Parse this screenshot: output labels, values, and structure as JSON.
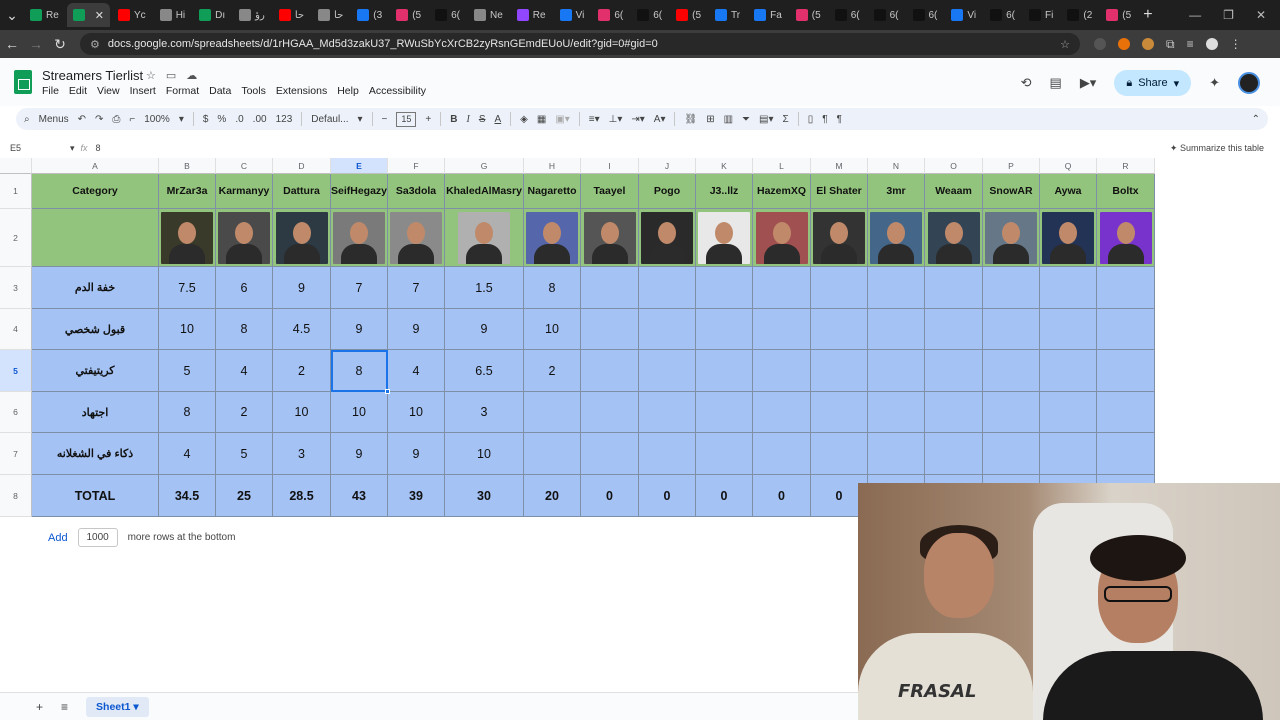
{
  "browser": {
    "tabs": [
      {
        "label": "Re",
        "color": "#0f9d58",
        "active": false
      },
      {
        "label": "",
        "color": "#0f9d58",
        "active": true
      },
      {
        "label": "Yc",
        "color": "#ff0000",
        "active": false
      },
      {
        "label": "Hi",
        "color": "#888888",
        "active": false
      },
      {
        "label": "Dı",
        "color": "#0f9d58",
        "active": false
      },
      {
        "label": "رؤ",
        "color": "#888888",
        "active": false
      },
      {
        "label": "حا",
        "color": "#ff0000",
        "active": false
      },
      {
        "label": "حا",
        "color": "#888888",
        "active": false
      },
      {
        "label": "(3",
        "color": "#1877f2",
        "active": false
      },
      {
        "label": "(5",
        "color": "#e1306c",
        "active": false
      },
      {
        "label": "6(",
        "color": "#111111",
        "active": false
      },
      {
        "label": "Ne",
        "color": "#888888",
        "active": false
      },
      {
        "label": "Re",
        "color": "#9146ff",
        "active": false
      },
      {
        "label": "Vi",
        "color": "#1877f2",
        "active": false
      },
      {
        "label": "6(",
        "color": "#e1306c",
        "active": false
      },
      {
        "label": "6(",
        "color": "#111111",
        "active": false
      },
      {
        "label": "(5",
        "color": "#ff0000",
        "active": false
      },
      {
        "label": "Tr",
        "color": "#1877f2",
        "active": false
      },
      {
        "label": "Fa",
        "color": "#1877f2",
        "active": false
      },
      {
        "label": "(5",
        "color": "#e1306c",
        "active": false
      },
      {
        "label": "6(",
        "color": "#111111",
        "active": false
      },
      {
        "label": "6(",
        "color": "#111111",
        "active": false
      },
      {
        "label": "6(",
        "color": "#111111",
        "active": false
      },
      {
        "label": "Vi",
        "color": "#1877f2",
        "active": false
      },
      {
        "label": "6(",
        "color": "#111111",
        "active": false
      },
      {
        "label": "Fi",
        "color": "#111111",
        "active": false
      },
      {
        "label": "(2",
        "color": "#111111",
        "active": false
      },
      {
        "label": "(5",
        "color": "#e1306c",
        "active": false
      }
    ],
    "new_tab": "+",
    "url": "docs.google.com/spreadsheets/d/1rHGAA_Md5d3zakU37_RWuSbYcXrCB2zyRsnGEmdEUoU/edit?gid=0#gid=0"
  },
  "sheets": {
    "title": "Streamers Tierlist",
    "menu": [
      "File",
      "Edit",
      "View",
      "Insert",
      "Format",
      "Data",
      "Tools",
      "Extensions",
      "Help",
      "Accessibility"
    ],
    "share_label": "Share",
    "toolbar": {
      "menus_label": "Menus",
      "zoom": "100%",
      "currency": "$",
      "percent": "%",
      "dec_decrease": ".0",
      "dec_increase": ".00",
      "number_format": "123",
      "font": "Defaul...",
      "font_size": "15",
      "bold": "B",
      "italic": "I"
    },
    "formula_bar": {
      "cell_ref": "E5",
      "fx": "fx",
      "value": "8",
      "summarize": "Summarize this table"
    },
    "columns": [
      "A",
      "B",
      "C",
      "D",
      "E",
      "F",
      "G",
      "H",
      "I",
      "J",
      "K",
      "L",
      "M",
      "N",
      "O",
      "P",
      "Q",
      "R"
    ],
    "rows": [
      "1",
      "2",
      "3",
      "4",
      "5",
      "6",
      "7",
      "8"
    ],
    "selected_column": "E",
    "selected_row": "5",
    "header_label": "Category",
    "streamers": [
      "MrZar3a",
      "Karmanyy",
      "Dattura",
      "SeifHegazy",
      "Sa3dola",
      "KhaledAlMasry",
      "Nagaretto",
      "Taayel",
      "Pogo",
      "J3..llz",
      "HazemXQ",
      "El Shater",
      "3mr",
      "Weaam",
      "SnowAR",
      "Aywa",
      "Boltx"
    ],
    "categories": [
      {
        "label": "خفة الدم",
        "values": [
          "7.5",
          "6",
          "9",
          "7",
          "7",
          "1.5",
          "8",
          "",
          "",
          "",
          "",
          "",
          "",
          "",
          "",
          "",
          ""
        ]
      },
      {
        "label": "قبول شخصي",
        "values": [
          "10",
          "8",
          "4.5",
          "9",
          "9",
          "9",
          "10",
          "",
          "",
          "",
          "",
          "",
          "",
          "",
          "",
          "",
          ""
        ]
      },
      {
        "label": "كريتيفتي",
        "values": [
          "5",
          "4",
          "2",
          "8",
          "4",
          "6.5",
          "2",
          "",
          "",
          "",
          "",
          "",
          "",
          "",
          "",
          "",
          ""
        ]
      },
      {
        "label": "اجتهاد",
        "values": [
          "8",
          "2",
          "10",
          "10",
          "10",
          "3",
          "",
          "",
          "",
          "",
          "",
          "",
          "",
          "",
          "",
          "",
          ""
        ]
      },
      {
        "label": "ذكاء في الشغلانه",
        "values": [
          "4",
          "5",
          "3",
          "9",
          "9",
          "10",
          "",
          "",
          "",
          "",
          "",
          "",
          "",
          "",
          "",
          "",
          ""
        ]
      }
    ],
    "total": {
      "label": "TOTAL",
      "values": [
        "34.5",
        "25",
        "28.5",
        "43",
        "39",
        "30",
        "20",
        "0",
        "0",
        "0",
        "0",
        "0",
        "",
        "",
        "",
        "",
        ""
      ]
    },
    "add_rows": {
      "button": "Add",
      "count": "1000",
      "suffix": "more rows at the bottom"
    },
    "sheet_tab": "Sheet1"
  },
  "colors": {
    "green": "#93c47d",
    "blue": "#a4c2f4",
    "selection": "#1a73e8"
  },
  "webcam": {
    "shirt_text": "FRASAL"
  }
}
